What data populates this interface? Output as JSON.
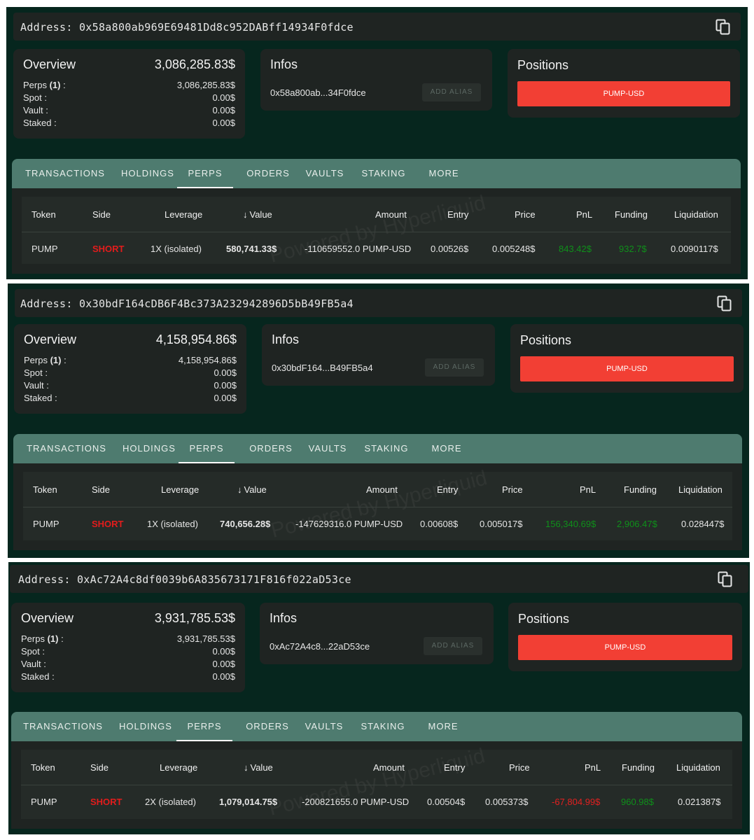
{
  "labels": {
    "overview": "Overview",
    "infos": "Infos",
    "positions": "Positions",
    "perps_label": "Perps",
    "perps_count": "(1)",
    "perps_suffix": " :",
    "spot": "Spot :",
    "vault": "Vault :",
    "staked": "Staked :",
    "add_alias": "ADD ALIAS",
    "watermark": "Powered by Hyperliquid"
  },
  "tabs": [
    "TRANSACTIONS",
    "HOLDINGS",
    "PERPS",
    "ORDERS",
    "VAULTS",
    "STAKING",
    "MORE"
  ],
  "active_tab": "PERPS",
  "columns": [
    "Token",
    "Side",
    "Leverage",
    "Value",
    "Amount",
    "Entry",
    "Price",
    "PnL",
    "Funding",
    "Liquidation"
  ],
  "sort_icon": "arrow-down-icon",
  "colors": {
    "background": "#06261e",
    "card": "#1f2422",
    "tabs": "#4e7b6f",
    "position_button": "#f23f34",
    "short": "#e21c1c",
    "pnl_positive": "#0f8f1a",
    "pnl_negative": "#e22020"
  },
  "wallets": [
    {
      "address_line": "Address: 0x58a800ab969E69481Dd8c952DABff14934F0fdce",
      "overview": {
        "total": "3,086,285.83$",
        "perps": "3,086,285.83$",
        "spot": "0.00$",
        "vault": "0.00$",
        "staked": "0.00$"
      },
      "short_address": "0x58a800ab...34F0fdce",
      "position": "PUMP-USD",
      "row": {
        "token": "PUMP",
        "side": "SHORT",
        "leverage": "1X (isolated)",
        "value": "580,741.33$",
        "amount": "-110659552.0 PUMP-USD",
        "entry": "0.00526$",
        "price": "0.005248$",
        "pnl": "843.42$",
        "funding": "932.7$",
        "liquidation": "0.0090117$"
      }
    },
    {
      "address_line": "Address: 0x30bdF164cDB6F4Bc373A232942896D5bB49FB5a4",
      "overview": {
        "total": "4,158,954.86$",
        "perps": "4,158,954.86$",
        "spot": "0.00$",
        "vault": "0.00$",
        "staked": "0.00$"
      },
      "short_address": "0x30bdF164...B49FB5a4",
      "position": "PUMP-USD",
      "row": {
        "token": "PUMP",
        "side": "SHORT",
        "leverage": "1X (isolated)",
        "value": "740,656.28$",
        "amount": "-147629316.0 PUMP-USD",
        "entry": "0.00608$",
        "price": "0.005017$",
        "pnl": "156,340.69$",
        "funding": "2,906.47$",
        "liquidation": "0.028447$"
      }
    },
    {
      "address_line": "Address: 0xAc72A4c8df0039b6A835673171F816f022aD53ce",
      "overview": {
        "total": "3,931,785.53$",
        "perps": "3,931,785.53$",
        "spot": "0.00$",
        "vault": "0.00$",
        "staked": "0.00$"
      },
      "short_address": "0xAc72A4c8...22aD53ce",
      "position": "PUMP-USD",
      "row": {
        "token": "PUMP",
        "side": "SHORT",
        "leverage": "2X (isolated)",
        "value": "1,079,014.75$",
        "amount": "-200821655.0 PUMP-USD",
        "entry": "0.00504$",
        "price": "0.005373$",
        "pnl": "-67,804.99$",
        "funding": "960.98$",
        "liquidation": "0.021387$"
      }
    }
  ]
}
